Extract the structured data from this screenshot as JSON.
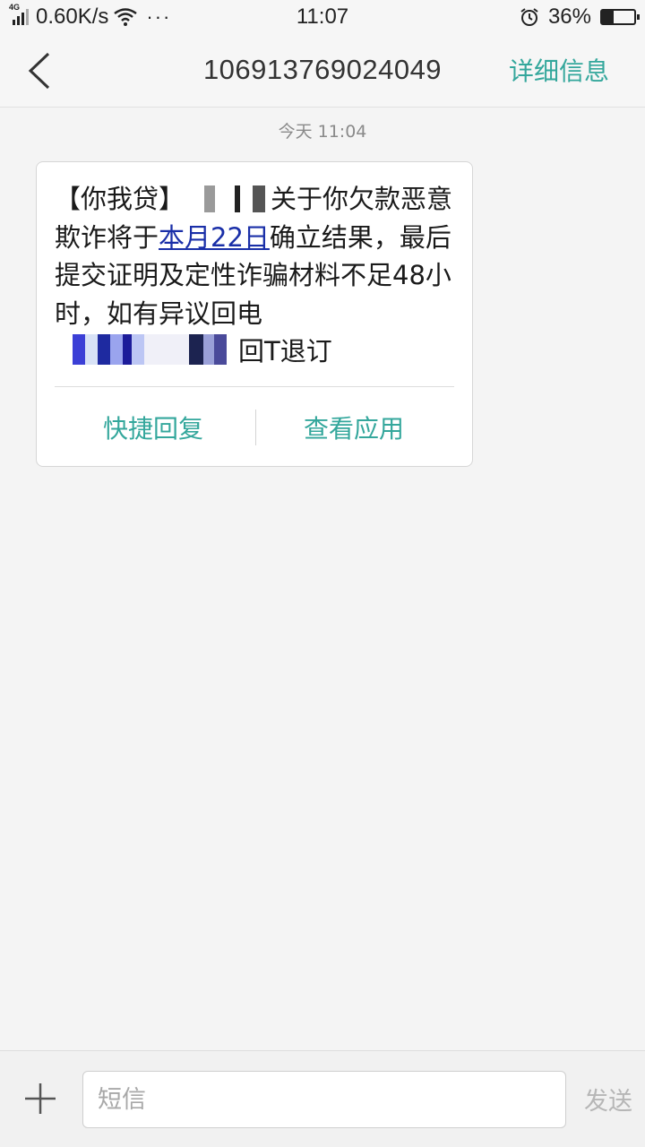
{
  "status_bar": {
    "network": "4G",
    "speed": "0.60K/s",
    "dots": "···",
    "time": "11:07",
    "battery": "36%",
    "battery_level": 0.36
  },
  "header": {
    "title": "106913769024049",
    "detail": "详细信息"
  },
  "conversation": {
    "timestamp": "今天 11:04",
    "message": {
      "part1": "【你我贷】",
      "part2": "关于你欠款恶意欺诈将于",
      "link": "本月22日",
      "part3": "确立结果，最后提交证明及定性诈骗材料不足48小时，如有异议回电",
      "part4": "回T退订"
    },
    "actions": {
      "quick_reply": "快捷回复",
      "view_app": "查看应用"
    }
  },
  "composer": {
    "placeholder": "短信",
    "send": "发送"
  }
}
